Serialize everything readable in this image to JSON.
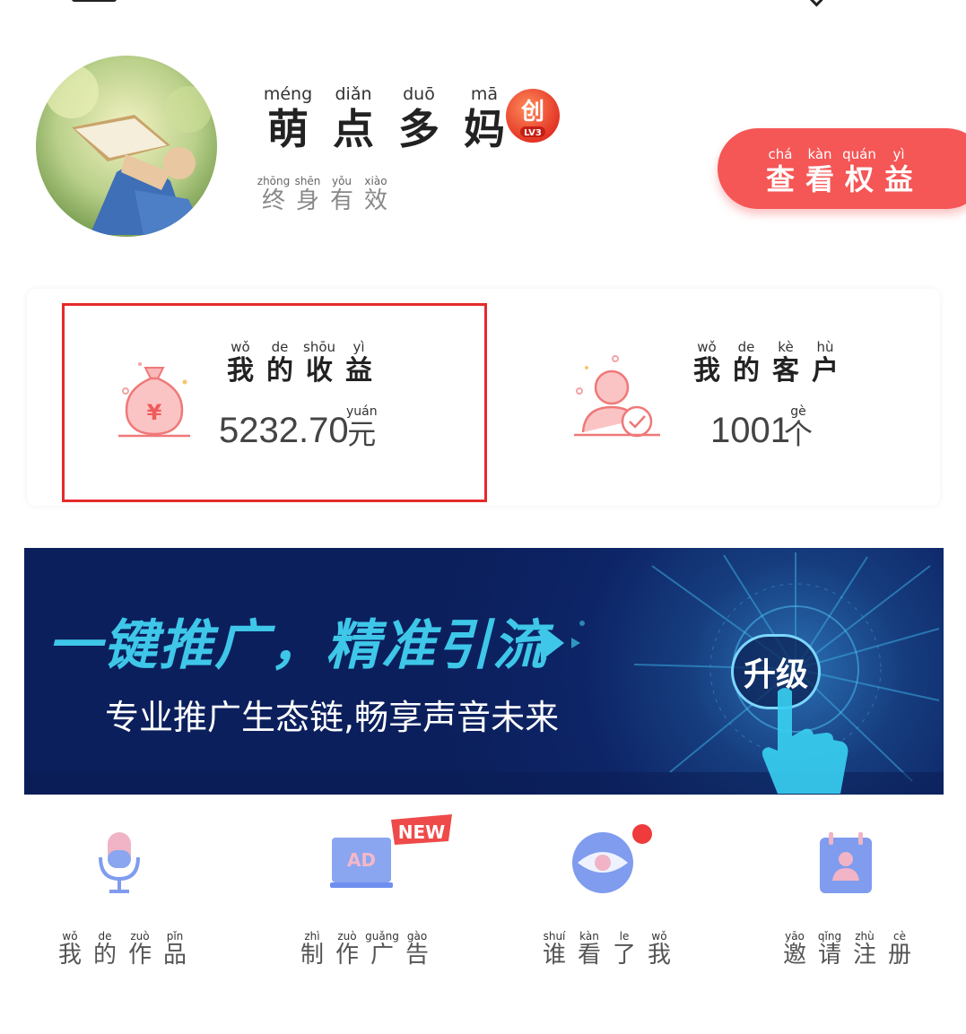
{
  "profile": {
    "name_chars": [
      {
        "py": "méng",
        "hz": "萌"
      },
      {
        "py": "diǎn",
        "hz": "点"
      },
      {
        "py": "duō",
        "hz": "多"
      },
      {
        "py": "mā",
        "hz": "妈"
      }
    ],
    "level_badge": "LV3",
    "level_char": "创",
    "validity_chars": [
      {
        "py": "zhōng",
        "hz": "终"
      },
      {
        "py": "shēn",
        "hz": "身"
      },
      {
        "py": "yǒu",
        "hz": "有"
      },
      {
        "py": "xiào",
        "hz": "效"
      }
    ],
    "rights_button_chars": [
      {
        "py": "chá",
        "hz": "查"
      },
      {
        "py": "kàn",
        "hz": "看"
      },
      {
        "py": "quán",
        "hz": "权"
      },
      {
        "py": "yì",
        "hz": "益"
      }
    ]
  },
  "stats": {
    "earnings": {
      "label_chars": [
        {
          "py": "wǒ",
          "hz": "我"
        },
        {
          "py": "de",
          "hz": "的"
        },
        {
          "py": "shōu",
          "hz": "收"
        },
        {
          "py": "yì",
          "hz": "益"
        }
      ],
      "value": "5232.70",
      "unit": {
        "py": "yuán",
        "hz": "元"
      },
      "icon": "money-bag-icon"
    },
    "customers": {
      "label_chars": [
        {
          "py": "wǒ",
          "hz": "我"
        },
        {
          "py": "de",
          "hz": "的"
        },
        {
          "py": "kè",
          "hz": "客"
        },
        {
          "py": "hù",
          "hz": "户"
        }
      ],
      "value": "1001",
      "unit": {
        "py": "gè",
        "hz": "个"
      },
      "icon": "customer-icon"
    }
  },
  "banner": {
    "headline": "一键推广，精准引流",
    "subline": "专业推广生态链,畅享声音未来",
    "button": "升级"
  },
  "menu": [
    {
      "icon": "microphone-icon",
      "chars": [
        {
          "py": "wǒ",
          "hz": "我"
        },
        {
          "py": "de",
          "hz": "的"
        },
        {
          "py": "zuò",
          "hz": "作"
        },
        {
          "py": "pǐn",
          "hz": "品"
        }
      ]
    },
    {
      "icon": "ad-icon",
      "badge": "NEW",
      "chars": [
        {
          "py": "zhì",
          "hz": "制"
        },
        {
          "py": "zuò",
          "hz": "作"
        },
        {
          "py": "guǎng",
          "hz": "广"
        },
        {
          "py": "gào",
          "hz": "告"
        }
      ]
    },
    {
      "icon": "eye-icon",
      "chars": [
        {
          "py": "shuí",
          "hz": "谁"
        },
        {
          "py": "kàn",
          "hz": "看"
        },
        {
          "py": "le",
          "hz": "了"
        },
        {
          "py": "wǒ",
          "hz": "我"
        }
      ]
    },
    {
      "icon": "invite-icon",
      "chars": [
        {
          "py": "yāo",
          "hz": "邀"
        },
        {
          "py": "qǐng",
          "hz": "请"
        },
        {
          "py": "zhù",
          "hz": "注"
        },
        {
          "py": "cè",
          "hz": "册"
        }
      ]
    }
  ],
  "colors": {
    "accent_red": "#f55656",
    "highlight_border": "#e52a2a",
    "banner_bg": "#0b1f5c",
    "banner_headline": "#3ec7e8",
    "icon_blue": "#6f8ff0"
  }
}
